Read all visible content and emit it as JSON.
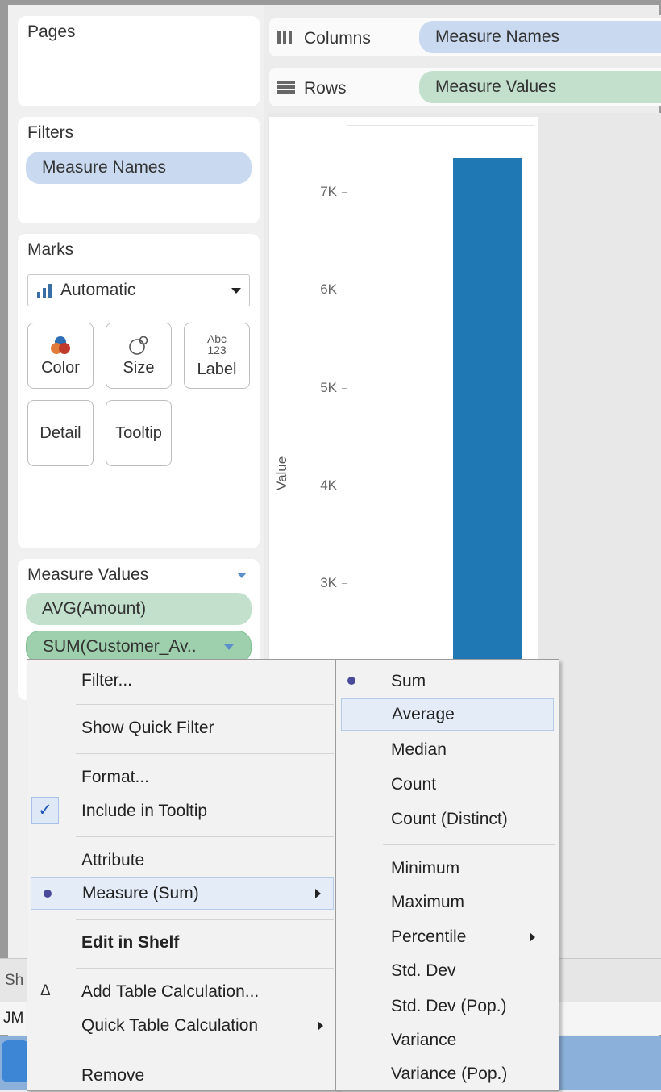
{
  "shelves": {
    "pages_label": "Pages",
    "columns_label": "Columns",
    "columns_pill": "Measure Names",
    "rows_label": "Rows",
    "rows_pill": "Measure Values"
  },
  "filters": {
    "title": "Filters",
    "pill": "Measure Names"
  },
  "marks": {
    "title": "Marks",
    "dropdown_value": "Automatic",
    "buttons": {
      "color": "Color",
      "size": "Size",
      "label": "Label",
      "label_icon": "Abc 123",
      "detail": "Detail",
      "tooltip": "Tooltip"
    }
  },
  "measure_values": {
    "title": "Measure Values",
    "items": [
      "AVG(Amount)",
      "SUM(Customer_Av.."
    ]
  },
  "chart": {
    "ylabel": "Value",
    "bar_color": "#1f77b4"
  },
  "chart_data": {
    "type": "bar",
    "categories": [
      ""
    ],
    "values": [
      7350
    ],
    "title": "",
    "xlabel": "",
    "ylabel": "Value",
    "yticks": [
      "7K",
      "6K",
      "5K",
      "4K",
      "3K"
    ],
    "ylim_visible": [
      2300,
      7700
    ],
    "grid": false
  },
  "context_menu": {
    "items": {
      "filter": "Filter...",
      "show_quick_filter": "Show Quick Filter",
      "format": "Format...",
      "include_tooltip": "Include in Tooltip",
      "attribute": "Attribute",
      "measure_sum": "Measure (Sum)",
      "edit_in_shelf": "Edit in Shelf",
      "add_table_calc": "Add Table Calculation...",
      "quick_table_calc": "Quick Table Calculation",
      "remove": "Remove"
    },
    "check_glyph": "✓",
    "delta_glyph": "Δ"
  },
  "submenu": {
    "items": {
      "sum": "Sum",
      "average": "Average",
      "median": "Median",
      "count": "Count",
      "count_distinct": "Count (Distinct)",
      "minimum": "Minimum",
      "maximum": "Maximum",
      "percentile": "Percentile",
      "std_dev": "Std. Dev",
      "std_dev_pop": "Std. Dev (Pop.)",
      "variance": "Variance",
      "variance_pop": "Variance (Pop.)"
    }
  },
  "background": {
    "clip1": "Sh",
    "clip2": "JM"
  }
}
